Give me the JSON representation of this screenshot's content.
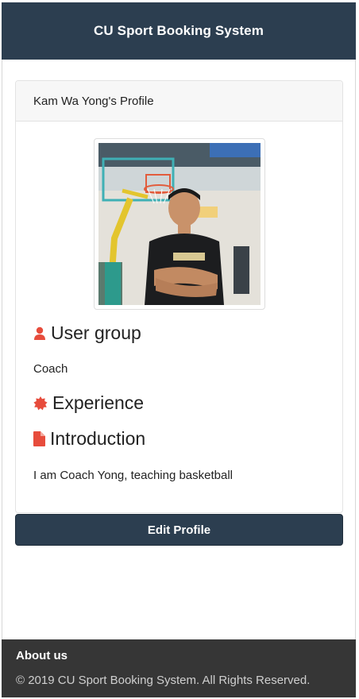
{
  "navbar": {
    "title": "CU Sport Booking System"
  },
  "profile": {
    "header": "Kam Wa Yong's Profile",
    "sections": {
      "user_group": {
        "heading": "User group",
        "value": "Coach"
      },
      "experience": {
        "heading": "Experience"
      },
      "introduction": {
        "heading": "Introduction",
        "value": "I am Coach Yong, teaching basketball"
      }
    },
    "edit_button": "Edit Profile"
  },
  "footer": {
    "title": "About us",
    "copyright": "© 2019 CU Sport Booking System. All Rights Reserved."
  },
  "colors": {
    "primary": "#2c3e50",
    "icon_red": "#e74c3c",
    "footer_bg": "#363636"
  }
}
